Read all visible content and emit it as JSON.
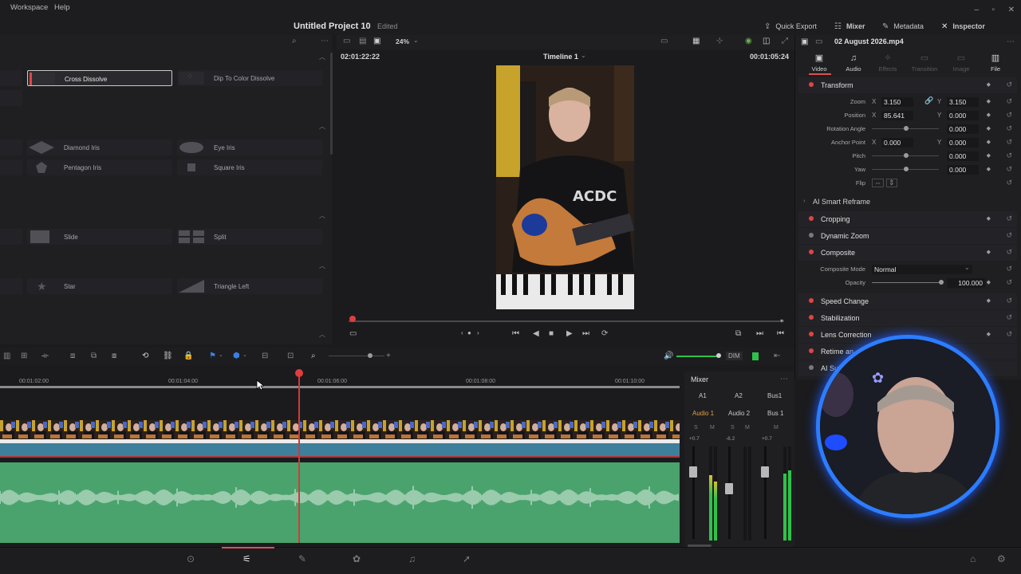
{
  "menu": {
    "items": [
      "Workspace",
      "Help"
    ]
  },
  "window_controls": [
    "–",
    "▫",
    "✕"
  ],
  "header": {
    "project_title": "Untitled Project 10",
    "project_status": "Edited",
    "quick_export": "Quick Export",
    "mixer": "Mixer",
    "metadata": "Metadata",
    "inspector": "Inspector"
  },
  "viewer": {
    "zoom": "24%",
    "timecode_left": "02:01:22:22",
    "timeline_name": "Timeline 1",
    "timecode_right": "00:01:05:24"
  },
  "effects": {
    "items": [
      {
        "label": "Cross Dissolve",
        "selected": true
      },
      {
        "label": "Dip To Color Dissolve"
      },
      {
        "label": "Diamond Iris"
      },
      {
        "label": "Eye Iris"
      },
      {
        "label": "Pentagon Iris"
      },
      {
        "label": "Square Iris"
      },
      {
        "label": "Slide"
      },
      {
        "label": "Split"
      },
      {
        "label": "Star"
      },
      {
        "label": "Triangle Left"
      }
    ]
  },
  "inspector": {
    "clip_name": "02 August 2026.mp4",
    "tabs": [
      "Video",
      "Audio",
      "Effects",
      "Transition",
      "Image",
      "File"
    ],
    "sections": {
      "transform": "Transform",
      "smart_reframe": "AI Smart Reframe",
      "cropping": "Cropping",
      "dynamic_zoom": "Dynamic Zoom",
      "composite": "Composite",
      "speed_change": "Speed Change",
      "stabilization": "Stabilization",
      "lens_correction": "Lens Correction",
      "retime": "Retime an",
      "ai_sup": "AI Su"
    },
    "params": {
      "zoom": {
        "label": "Zoom",
        "x_axis": "X",
        "x": "3.150",
        "y_axis": "Y",
        "y": "3.150"
      },
      "position": {
        "label": "Position",
        "x_axis": "X",
        "x": "85.641",
        "y_axis": "Y",
        "y": "0.000"
      },
      "rotation": {
        "label": "Rotation Angle",
        "value": "0.000"
      },
      "anchor": {
        "label": "Anchor Point",
        "x_axis": "X",
        "x": "0.000",
        "y_axis": "Y",
        "y": "0.000"
      },
      "pitch": {
        "label": "Pitch",
        "value": "0.000"
      },
      "yaw": {
        "label": "Yaw",
        "value": "0.000"
      },
      "flip": {
        "label": "Flip"
      },
      "composite_mode": {
        "label": "Composite Mode",
        "value": "Normal"
      },
      "opacity": {
        "label": "Opacity",
        "value": "100.000"
      }
    }
  },
  "timeline": {
    "ruler": [
      "00:01:02:00",
      "00:01:04:00",
      "00:01:06:00",
      "00:01:08:00",
      "00:01:10:00"
    ]
  },
  "mixer": {
    "title": "Mixer",
    "channels": [
      {
        "id": "A1",
        "name": "Audio 1",
        "active": true,
        "level": "+0.7",
        "s": "S",
        "m": "M"
      },
      {
        "id": "A2",
        "name": "Audio 2",
        "active": false,
        "level": "-6.2",
        "s": "S",
        "m": "M"
      },
      {
        "id": "Bus1",
        "name": "Bus 1",
        "active": false,
        "level": "+0.7",
        "m": "M"
      }
    ],
    "dim_label": "DIM"
  },
  "colors": {
    "accent": "#e05050",
    "clip_video": "#2f6a8a",
    "clip_audio": "#4aa36d",
    "webcam_ring": "#2c7dff"
  }
}
